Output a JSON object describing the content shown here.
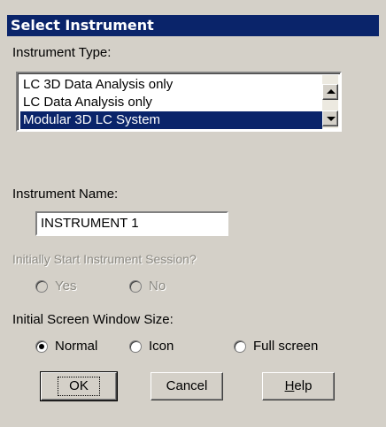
{
  "window": {
    "title": "Select Instrument"
  },
  "instrument_type": {
    "label": "Instrument Type:",
    "items": [
      {
        "label": "LC 3D Data Analysis only",
        "selected": false
      },
      {
        "label": "LC Data Analysis only",
        "selected": false
      },
      {
        "label": "Modular 3D LC System",
        "selected": true
      }
    ]
  },
  "instrument_name": {
    "label": "Instrument Name:",
    "value": "INSTRUMENT 1"
  },
  "start_session": {
    "label": "Initially Start Instrument Session?",
    "options": [
      {
        "label": "Yes",
        "checked": false
      },
      {
        "label": "No",
        "checked": false
      }
    ]
  },
  "window_size": {
    "label": "Initial Screen Window Size:",
    "options": [
      {
        "label": "Normal",
        "checked": true
      },
      {
        "label": "Icon",
        "checked": false
      },
      {
        "label": "Full screen",
        "checked": false
      }
    ]
  },
  "buttons": {
    "ok": "OK",
    "cancel": "Cancel",
    "help_mnemonic": "H",
    "help_rest": "elp"
  },
  "colors": {
    "titlebar": "#0a246a",
    "dialog_bg": "#d4d0c8",
    "selection": "#0a246a"
  }
}
